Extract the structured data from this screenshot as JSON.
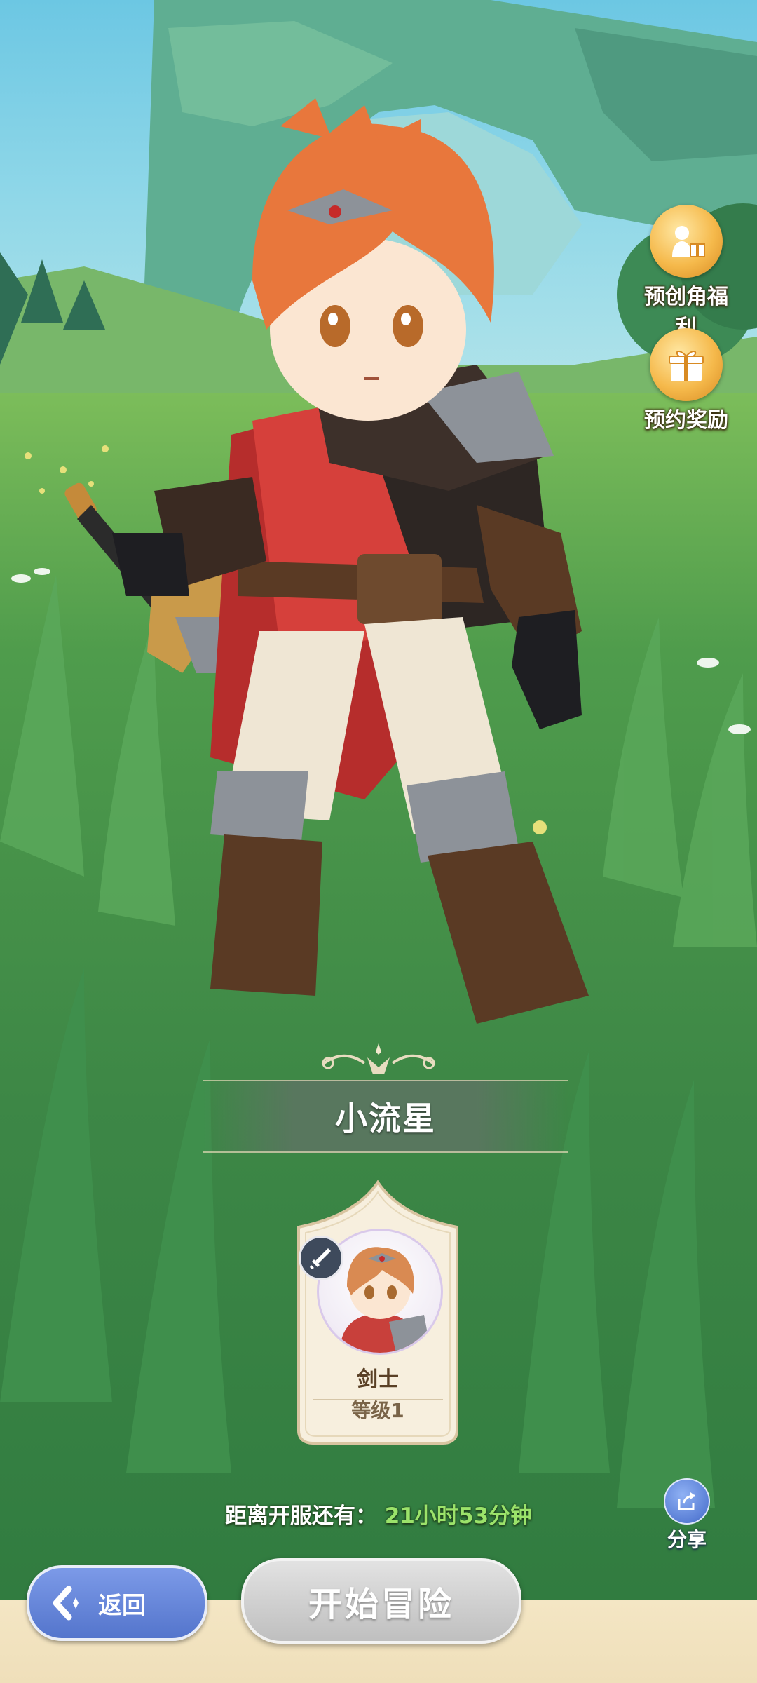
{
  "top_right": {
    "precreate_label": "预创角福利",
    "reserve_label": "预约奖励"
  },
  "character": {
    "name": "小流星"
  },
  "class_card": {
    "class_name": "剑士",
    "level": "等级1"
  },
  "countdown": {
    "label": "距离开服还有：",
    "value": "21小时53分钟"
  },
  "share": {
    "label": "分享"
  },
  "bottom": {
    "back_label": "返回",
    "start_label": "开始冒险"
  },
  "colors": {
    "back_button": "#5a7ad0",
    "start_button": "#c8c8c8",
    "countdown_value": "#9be36a",
    "reward_gold": "#f5b94b"
  }
}
